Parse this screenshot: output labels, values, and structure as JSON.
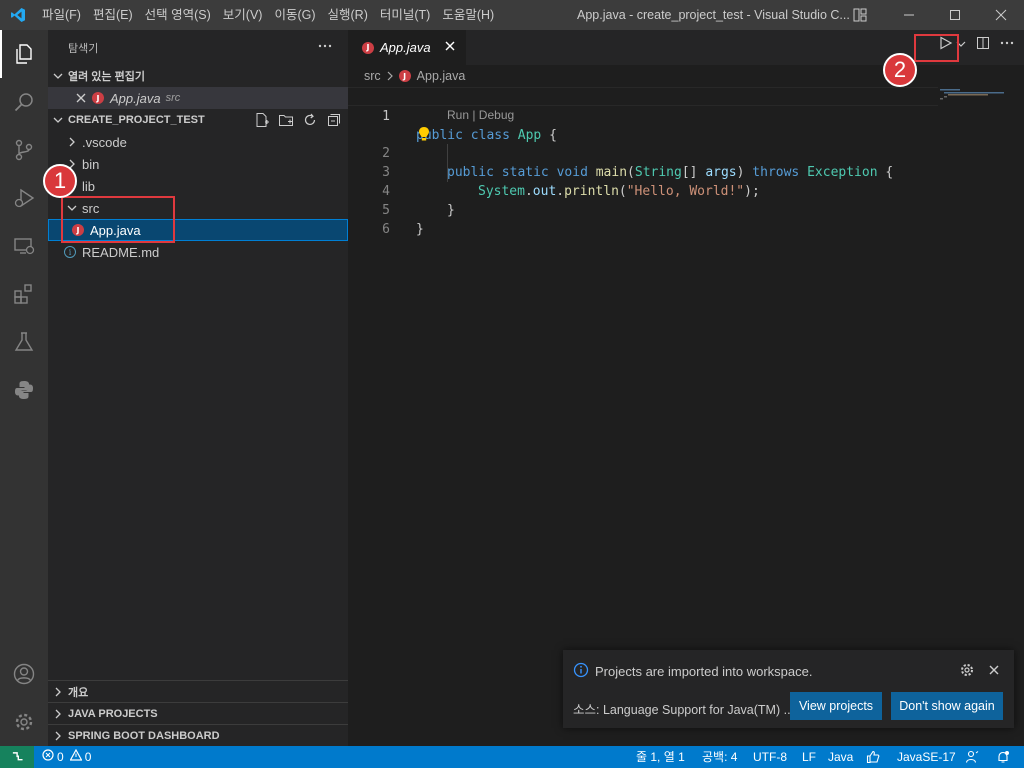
{
  "window": {
    "menu": [
      "파일(F)",
      "편집(E)",
      "선택 영역(S)",
      "보기(V)",
      "이동(G)",
      "실행(R)",
      "터미널(T)",
      "도움말(H)"
    ],
    "title": "App.java - create_project_test - Visual Studio C..."
  },
  "sidebar": {
    "header": "탐색기",
    "open_editors": {
      "title": "열려 있는 편집기",
      "items": [
        {
          "name": "App.java",
          "dir": "src"
        }
      ]
    },
    "workspace": {
      "title": "CREATE_PROJECT_TEST",
      "items": [
        {
          "label": ".vscode"
        },
        {
          "label": "bin"
        },
        {
          "label": "lib"
        },
        {
          "label": "src"
        },
        {
          "label": "App.java"
        },
        {
          "label": "README.md"
        }
      ]
    },
    "bottom_sections": [
      "개요",
      "JAVA PROJECTS",
      "SPRING BOOT DASHBOARD"
    ]
  },
  "editor": {
    "tab": "App.java",
    "breadcrumb": {
      "folder": "src",
      "file": "App.java"
    },
    "line_numbers": [
      "1",
      "2",
      "3",
      "4",
      "5",
      "6"
    ],
    "codelens": "Run | Debug",
    "code": {
      "l1": {
        "public": "public",
        "class": "class",
        "App": "App",
        "brace": "{"
      },
      "l2": {
        "public": "public",
        "static": "static",
        "void": "void",
        "main": "main",
        "paren": "(",
        "String": "String",
        "arr": "[]",
        "args": "args",
        "close": ")",
        "throws": "throws",
        "Exception": "Exception",
        "brace": "{"
      },
      "l3": {
        "System": "System",
        "dot1": ".",
        "out": "out",
        "dot2": ".",
        "println": "println",
        "open": "(",
        "str": "\"Hello, World!\"",
        "close": ");"
      },
      "l4": "}",
      "l5": "}"
    }
  },
  "notification": {
    "message": "Projects are imported into workspace.",
    "source": "소스: Language Support for Java(TM) ...",
    "btn_view": "View projects",
    "btn_dont": "Don't show again"
  },
  "statusbar": {
    "errors": "0",
    "warnings": "0",
    "position": "줄 1, 열 1",
    "spaces": "공백: 4",
    "encoding": "UTF-8",
    "eol": "LF",
    "language": "Java",
    "jdk": "JavaSE-17"
  },
  "annotations": {
    "badge1": "1",
    "badge2": "2"
  },
  "colors": {
    "accent": "#007acc",
    "annotation": "#e0393e",
    "java_icon": "#cc3e44"
  }
}
